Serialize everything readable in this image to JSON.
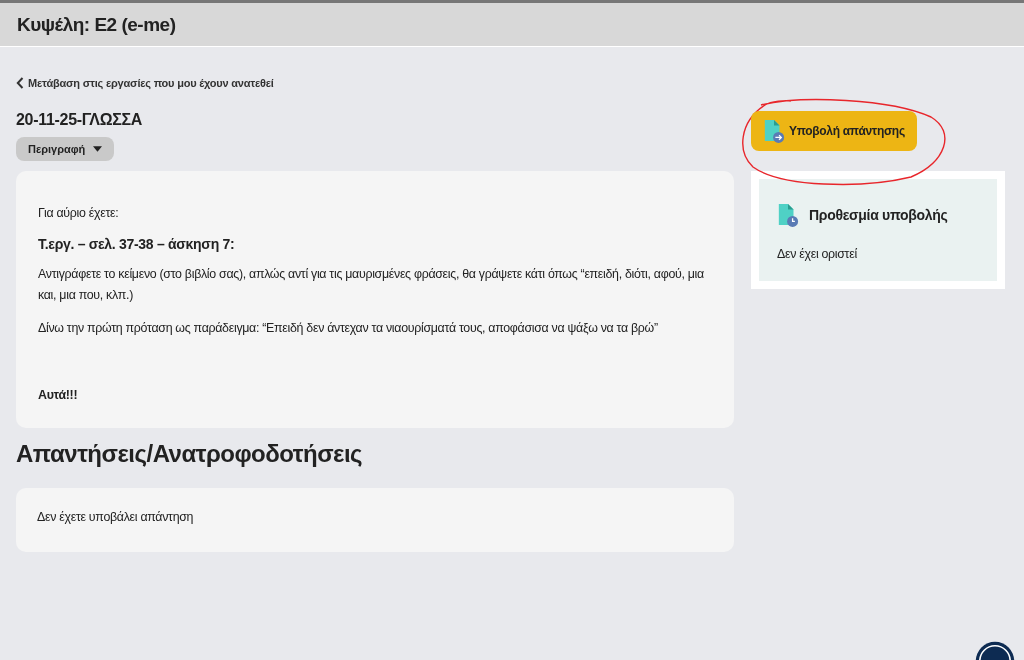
{
  "header": {
    "title": "Κυψέλη: Ε2 (e-me)"
  },
  "back_link": {
    "label": "Μετάβαση στις εργασίες που μου έχουν ανατεθεί"
  },
  "assignment": {
    "title": "20-11-25-ΓΛΩΣΣΑ",
    "description_toggle": {
      "label": "Περιγραφή",
      "expanded": true
    },
    "description": [
      {
        "kind": "text",
        "text": "Για αύριο έχετε:"
      },
      {
        "kind": "heading",
        "text": "Τ.εργ. – σελ. 37-38 – άσκηση 7:"
      },
      {
        "kind": "text",
        "text": "Αντιγράφετε το κείμενο (στο βιβλίο σας), απλώς αντί για τις μαυρισμένες φράσεις, θα γράψετε κάτι όπως “επειδή, διότι, αφού, μια και, μια που, κλπ.)"
      },
      {
        "kind": "text",
        "text": "Δίνω την πρώτη πρόταση ως παράδειγμα: “Επειδή δεν άντεχαν τα νιαουρίσματά τους, αποφάσισα να ψάξω να τα βρώ”"
      },
      {
        "kind": "spacer"
      },
      {
        "kind": "bold",
        "text": "Αυτά!!!"
      }
    ]
  },
  "answers": {
    "title": "Απαντήσεις/Ανατροφοδοτήσεις",
    "empty_text": "Δεν έχετε υποβάλει απάντηση"
  },
  "submit_button": {
    "label": "Υποβολή απάντησης",
    "circled": true
  },
  "deadline": {
    "title": "Προθεσμία υποβολής",
    "value": "Δεν έχει οριστεί"
  }
}
